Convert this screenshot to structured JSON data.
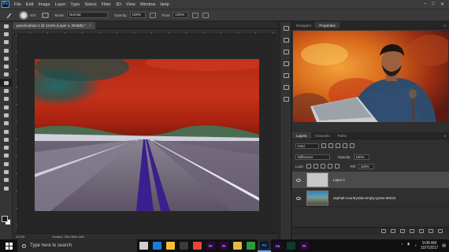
{
  "app": {
    "logo": "Ps",
    "menu": [
      "File",
      "Edit",
      "Image",
      "Layer",
      "Type",
      "Select",
      "Filter",
      "3D",
      "View",
      "Window",
      "Help"
    ]
  },
  "options": {
    "brush_size": "400",
    "mode_label": "Mode:",
    "mode_value": "Normal",
    "opacity_label": "Opacity:",
    "opacity_value": "100%",
    "flow_label": "Flow:",
    "flow_value": "100%"
  },
  "document": {
    "tab_title": "pexels-photo-1 @ 12.5% (Layer 1, RGB/8) *",
    "zoom": "12.5%",
    "doc_info": "Scratch: 536.9M/4.44G"
  },
  "navigator": {
    "tabs": [
      "Navigator",
      "Properties"
    ]
  },
  "layers_panel": {
    "tabs": [
      "Layers",
      "Channels",
      "Paths"
    ],
    "filter_value": "Kind",
    "blend_mode": "Difference",
    "opacity_label": "Opacity:",
    "opacity_value": "100%",
    "lock_label": "Lock:",
    "fill_label": "Fill:",
    "fill_value": "100%",
    "layers": [
      {
        "name": "Layer 1",
        "selected": true
      },
      {
        "name": "asphalt-countryside-empty-grass-68234",
        "selected": false
      }
    ]
  },
  "taskbar": {
    "search_placeholder": "Type here to search",
    "apps": [
      {
        "label": "",
        "icon": "task-view-icon",
        "color": "#cfcfcf",
        "text_color": "#111"
      },
      {
        "label": "",
        "icon": "edge-icon",
        "color": "#1f7ae0",
        "text_color": "#fff"
      },
      {
        "label": "",
        "icon": "file-explorer-icon",
        "color": "#f2c13a",
        "text_color": "#333"
      },
      {
        "label": "",
        "icon": "store-icon",
        "color": "#3a3a3a",
        "text_color": "#ccc"
      },
      {
        "label": "",
        "icon": "chrome-icon",
        "color": "#e8473a",
        "text_color": "#fff"
      },
      {
        "label": "Pr",
        "icon": "premiere-icon",
        "color": "#2a0a3a",
        "text_color": "#e38bff"
      },
      {
        "label": "Pr",
        "icon": "premiere-icon-2",
        "color": "#2a0a3a",
        "text_color": "#e38bff"
      },
      {
        "label": "",
        "icon": "folder-icon",
        "color": "#e6b840",
        "text_color": "#333"
      },
      {
        "label": "",
        "icon": "camtasia-icon",
        "color": "#2e9a3a",
        "text_color": "#fff"
      },
      {
        "label": "Ps",
        "icon": "photoshop-icon",
        "color": "#0f1b2d",
        "text_color": "#31a8ff",
        "active": true
      },
      {
        "label": "Ae",
        "icon": "after-effects-icon",
        "color": "#1c0b38",
        "text_color": "#c9a3ff"
      },
      {
        "label": "",
        "icon": "audition-icon",
        "color": "#0e3a2f",
        "text_color": "#5fe3c1"
      },
      {
        "label": "Pr",
        "icon": "premiere-icon-3",
        "color": "#2a0a3a",
        "text_color": "#e38bff"
      }
    ],
    "time": "9:08 AM",
    "date": "10/7/2017"
  }
}
